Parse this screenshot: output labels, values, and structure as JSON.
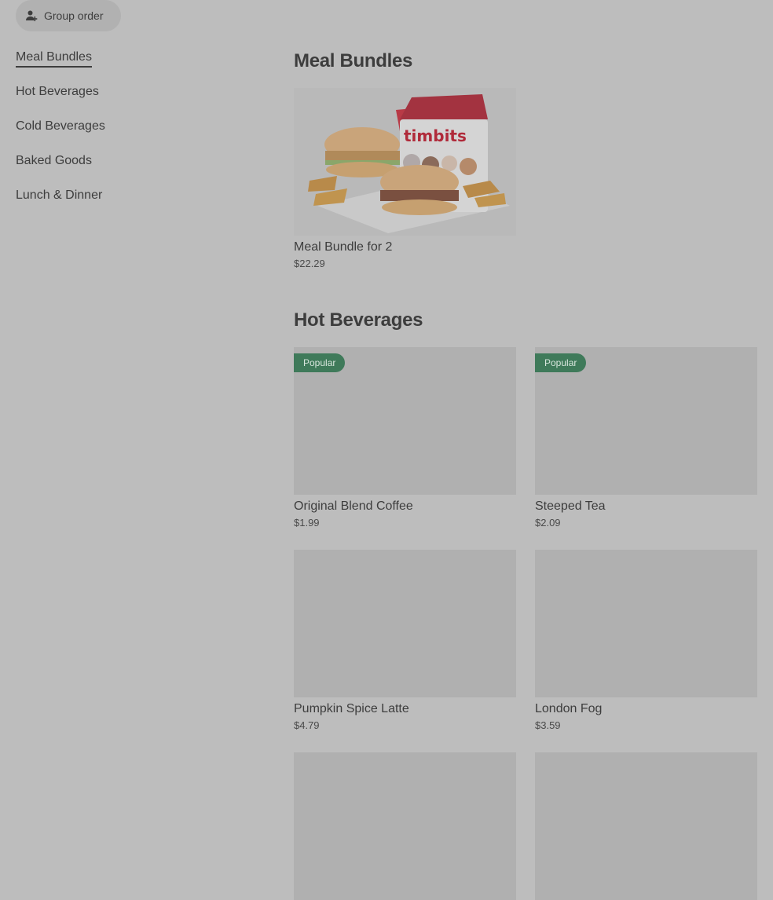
{
  "group_order": {
    "label": "Group order",
    "icon": "person-add-icon"
  },
  "sidebar": {
    "items": [
      {
        "label": "Meal Bundles",
        "active": true
      },
      {
        "label": "Hot Beverages"
      },
      {
        "label": "Cold Beverages"
      },
      {
        "label": "Baked Goods"
      },
      {
        "label": "Lunch & Dinner"
      }
    ]
  },
  "sections": {
    "meal_bundles": {
      "title": "Meal Bundles",
      "items": [
        {
          "name": "Meal Bundle for 2",
          "price": "$22.29",
          "image": "meal-bundle-photo",
          "box_text": "timbits"
        }
      ]
    },
    "hot_beverages": {
      "title": "Hot Beverages",
      "items": [
        {
          "name": "Original Blend Coffee",
          "price": "$1.99",
          "badge": "Popular"
        },
        {
          "name": "Steeped Tea",
          "price": "$2.09",
          "badge": "Popular"
        },
        {
          "name": "Pumpkin Spice Latte",
          "price": "$4.79"
        },
        {
          "name": "London Fog",
          "price": "$3.59"
        },
        {
          "name": "",
          "price": ""
        },
        {
          "name": "",
          "price": ""
        }
      ]
    }
  },
  "colors": {
    "background": "#bdbdbd",
    "placeholder": "#b0b0b0",
    "badge": "#3f7a5a",
    "text": "#3d3d3d"
  }
}
